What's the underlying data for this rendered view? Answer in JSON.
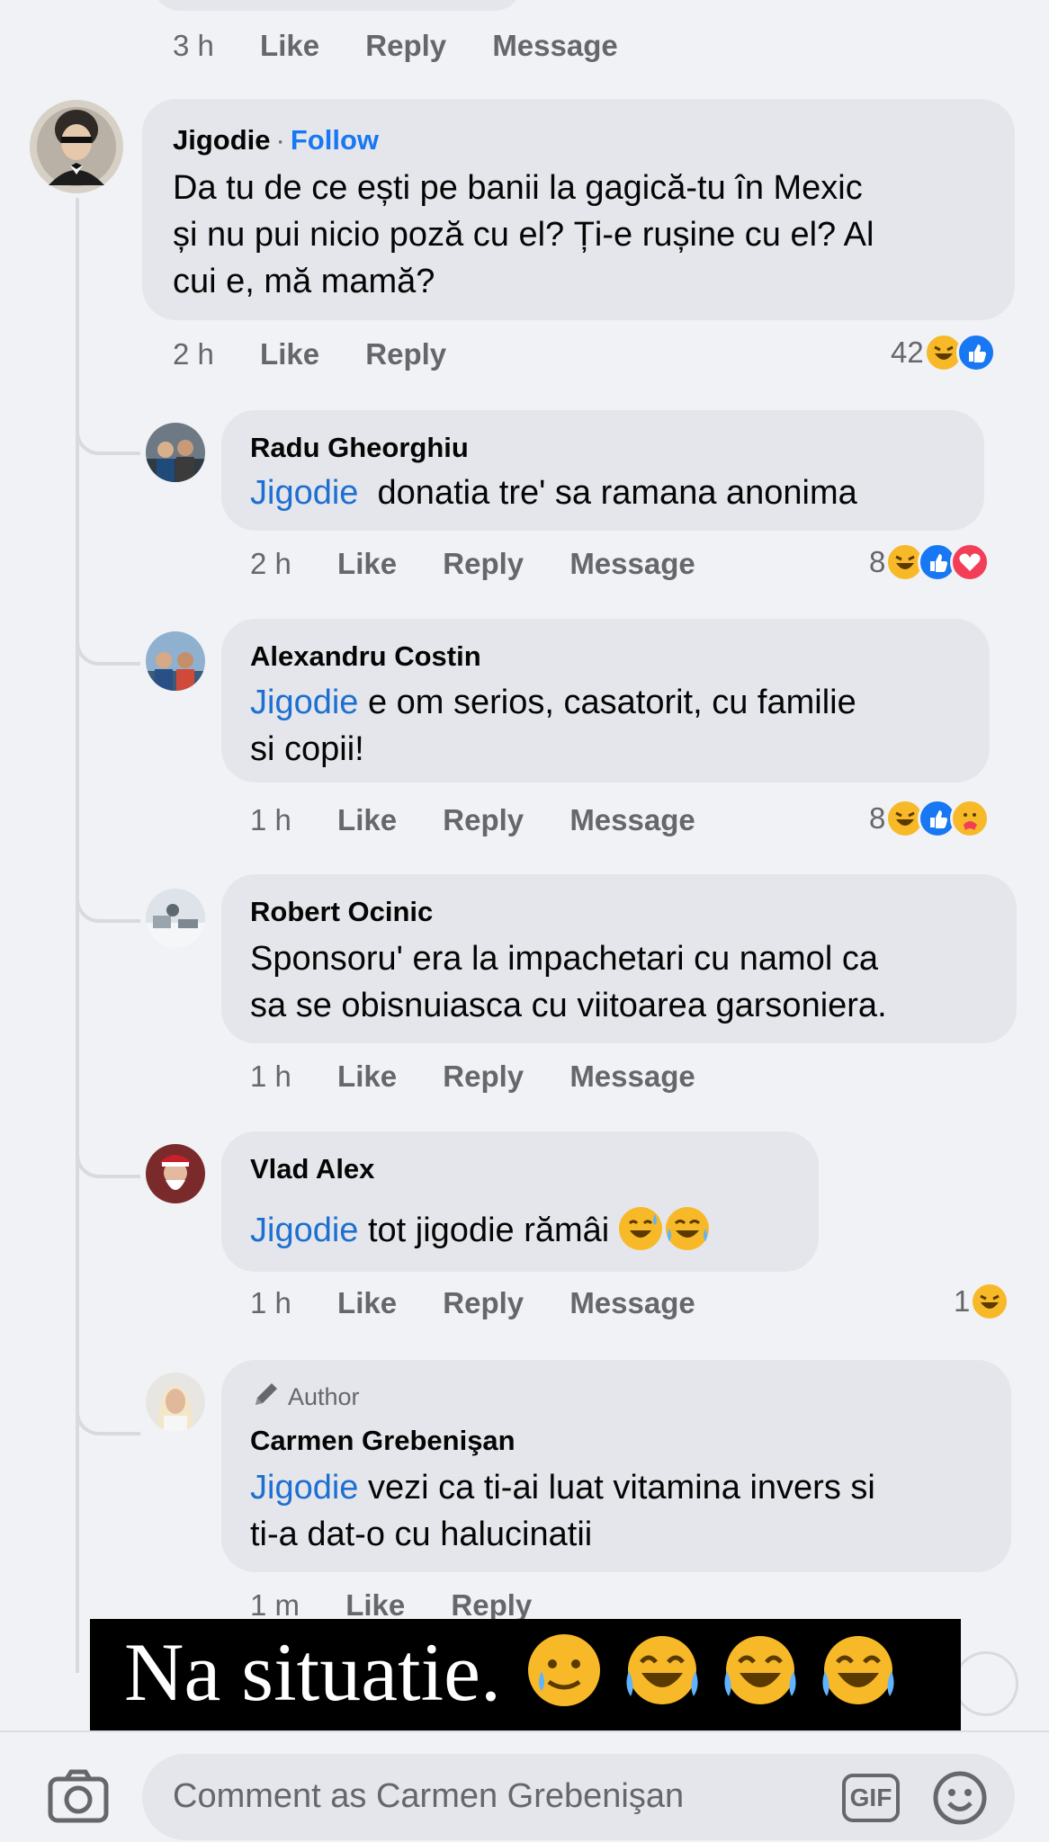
{
  "top_comment": {
    "time": "3 h",
    "like": "Like",
    "reply": "Reply",
    "message": "Message"
  },
  "main_comment": {
    "author": "Jigodie",
    "separator": "·",
    "follow": "Follow",
    "text_line1": "Da tu de ce ești pe banii la gagică-tu în Mexic",
    "text_line2": "și nu pui nicio poză cu el? Ți-e rușine cu el? Al",
    "text_line3": "cui e, mă mamă?",
    "time": "2 h",
    "like": "Like",
    "reply": "Reply",
    "reaction_count": "42"
  },
  "replies": [
    {
      "author": "Radu Gheorghiu",
      "mention": "Jigodie",
      "text_line1": "  donatia tre' sa ramana anonima",
      "time": "2 h",
      "like": "Like",
      "reply": "Reply",
      "message": "Message",
      "reaction_count": "8"
    },
    {
      "author": "Alexandru Costin",
      "mention": "Jigodie",
      "text_line1": " e om serios, casatorit, cu familie",
      "text_line2": "si copii!",
      "time": "1 h",
      "like": "Like",
      "reply": "Reply",
      "message": "Message",
      "reaction_count": "8"
    },
    {
      "author": "Robert Ocinic",
      "text_line1": "Sponsoru' era la impachetari cu namol ca",
      "text_line2": "sa se obisnuiasca cu viitoarea garsoniera.",
      "time": "1 h",
      "like": "Like",
      "reply": "Reply",
      "message": "Message"
    },
    {
      "author": "Vlad Alex",
      "mention": "Jigodie",
      "text_line1": " tot jigodie rămâi ",
      "time": "1 h",
      "like": "Like",
      "reply": "Reply",
      "message": "Message",
      "reaction_count": "1"
    },
    {
      "badge": "Author",
      "author": "Carmen Grebenişan",
      "mention": "Jigodie",
      "text_line1": " vezi ca ti-ai luat vitamina invers si",
      "text_line2": "ti-a dat-o cu halucinatii",
      "time": "1 m",
      "like": "Like",
      "reply": "Reply"
    }
  ],
  "overlay_banner": {
    "text": "Na situatie."
  },
  "composer": {
    "placeholder": "Comment as Carmen Grebenişan",
    "gif_label": "GIF"
  },
  "icons": {
    "camera": "camera-icon",
    "gif": "gif-icon",
    "emoji": "emoji-icon",
    "haha": "haha-reaction-icon",
    "like": "like-reaction-icon",
    "love": "love-reaction-icon",
    "care": "care-reaction-icon",
    "pencil": "pencil-icon"
  },
  "colors": {
    "background": "#f0f2f5",
    "bubble": "#e4e6eb",
    "mention": "#1d6fd1",
    "follow": "#1877f2",
    "secondary_text": "#65676b"
  }
}
